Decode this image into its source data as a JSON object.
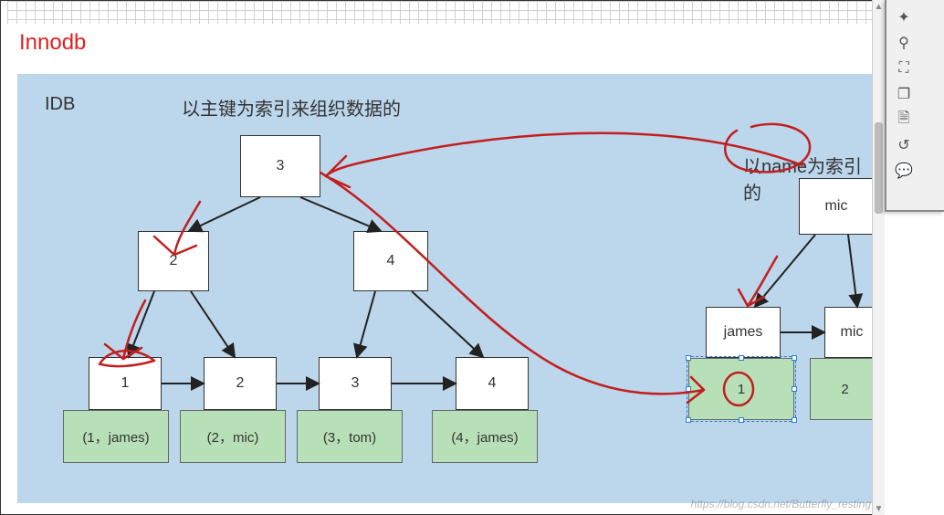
{
  "title": "Innodb",
  "idb_label": "IDB",
  "subtitle_primary": "以主键为索引来组织数据的",
  "subtitle_name": "以name为索引的",
  "left_tree": {
    "root": "3",
    "level2": [
      "2",
      "4"
    ],
    "leaves_white": [
      "1",
      "2",
      "3",
      "4"
    ],
    "leaves_green": [
      "(1，james)",
      "(2，mic)",
      "(3，tom)",
      "(4，james)"
    ]
  },
  "right_tree": {
    "root": "mic",
    "leaves_white": [
      "james",
      "mic"
    ],
    "leaves_green": [
      "1",
      "2"
    ]
  },
  "toolbar_icons": [
    "compass-icon",
    "magnify-icon",
    "fit-icon",
    "layers-icon",
    "page-icon",
    "rotate-icon",
    "comment-icon"
  ],
  "watermark": "https://blog.csdn.net/Butterfly_resting",
  "colors": {
    "panel": "#bcd6eb",
    "leaf": "#b8e0b8",
    "annot": "#c21e1e"
  }
}
